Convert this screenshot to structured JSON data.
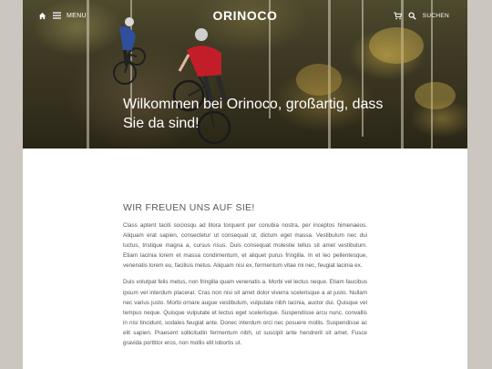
{
  "nav": {
    "home_icon": "home-icon",
    "menu_icon": "hamburger-icon",
    "menu_label": "MENU",
    "cart_icon": "cart-icon",
    "search_icon": "search-icon",
    "search_label": "SUCHEN"
  },
  "brand": {
    "logo": "ORINOCO"
  },
  "hero": {
    "title": "Wilkommen bei Orinoco, großartig, dass Sie da sind!"
  },
  "content": {
    "heading": "WIR FREUEN UNS AUF SIE!",
    "paragraphs": [
      "Class aptent taciti sociosqu ad litora torquent per conubia nostra, per inceptos himenaeos. Aliquam erat sapien, consectetur ut consequat ut, dictum eget massa. Vestibulum nec dui luctus, tristique magna a, cursus risus. Duis consequat molestie tellus sit amet vestibulum. Etiam lacinia lorem et massa condimentum, et aliquet purus fringilla. In et leo pellentesque, venenatis lorem eu, facilisis metus. Aliquam nisi ex, fermentum vitae mi nec, feugiat lacinia ex.",
      "Duis volutpat felis metus, non fringilla quam venenatis a. Morbi vel lectus neque. Etiam faucibus ipsum vel interdum placerat. Cras non nisi sit amet dolor viverra scelerisque a at justo. Nullam nec varius justo. Morbi ornare augue vestibulum, vulputate nibh lacinia, auctor dui. Quisque vel tempus neque. Quisque vulputate et lectus eget scelerisque. Suspendisse arcu nunc, convallis in nisi tincidunt, sodales feugiat ante. Donec interdum orci nec posuere mollis. Suspendisse ac elit sapien. Praesent sollicitudin fermentum nibh, ut suscipit ante hendrerit sit amet. Fusce gravida porttitor eros, non mollis elit lobortis ut."
    ]
  },
  "colors": {
    "page_background": "#cbc6bf",
    "content_background": "#ffffff",
    "heading_text": "#5a5a5a",
    "body_text": "#555555",
    "nav_text": "#ffffff"
  }
}
